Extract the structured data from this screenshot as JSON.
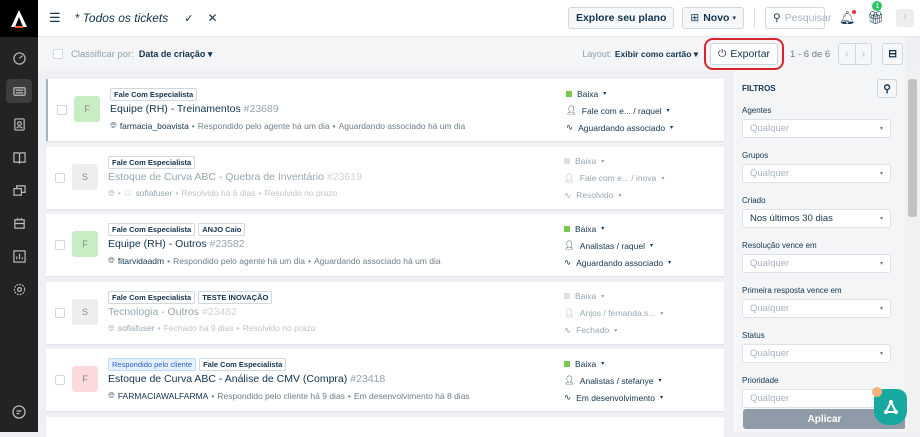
{
  "topbar": {
    "title": "* Todos os tickets",
    "explore": "Explore seu plano",
    "new": "Novo",
    "search_placeholder": "Pesquisar",
    "gift_badge": "1",
    "avatar": "I"
  },
  "subbar": {
    "sort_label": "Classificar por:",
    "sort_value": "Data de criação",
    "layout_label": "Layout:",
    "layout_value": "Exibir como cartão",
    "export": "Exportar",
    "pagination": "1 - 6 de 6"
  },
  "tickets": [
    {
      "avatar": "F",
      "avatar_color": "#c8ecc4",
      "tags": [
        "Fale Com Especialista"
      ],
      "subject": "Equipe (RH) - Treinamentos",
      "number": "#23689",
      "requester": "farmacia_boavista",
      "meta1": "Respondido pelo agente há um dia",
      "meta2": "Aguardando associado há um dia",
      "priority": "Baixa",
      "group": "Fale com e... / raquel",
      "status": "Aguardando associado",
      "dim": false
    },
    {
      "avatar": "S",
      "avatar_color": "#eeeeee",
      "tags": [
        "Fale Com Especialista"
      ],
      "subject": "Estoque de Curva ABC - Quebra de Inventário",
      "number": "#23619",
      "requester": "sofiafuser",
      "meta1": "Resolvido há 6 dias",
      "meta2": "Resolvido no prazo",
      "priority": "Baixa",
      "group": "Fale com e... / inova",
      "status": "Resolvido",
      "dim": true
    },
    {
      "avatar": "F",
      "avatar_color": "#c8ecc4",
      "tags": [
        "Fale Com Especialista",
        "ANJO Caio"
      ],
      "subject": "Equipe (RH) - Outros",
      "number": "#23582",
      "requester": "fitarvidaadm",
      "meta1": "Respondido pelo agente há um dia",
      "meta2": "Aguardando associado há um dia",
      "priority": "Baixa",
      "group": "Analistas / raquel",
      "status": "Aguardando associado",
      "dim": false
    },
    {
      "avatar": "S",
      "avatar_color": "#eeeeee",
      "tags": [
        "Fale Com Especialista",
        "TESTE INOVAÇÃO"
      ],
      "subject": "Tecnologia - Outros",
      "number": "#23482",
      "requester": "sofiafuser",
      "meta1": "Fechado há 9 dias",
      "meta2": "Resolvido no prazo",
      "priority": "Baixa",
      "group": "Anjos / fernanda.s...",
      "status": "Fechado",
      "dim": true
    },
    {
      "avatar": "F",
      "avatar_color": "#fcd9dc",
      "tags": [
        "Respondido pelo cliente",
        "Fale Com Especialista"
      ],
      "subject": "Estoque de Curva ABC - Análise de CMV (Compra)",
      "number": "#23418",
      "requester": "FARMACIAWALFARMA",
      "meta1": "Respondido pelo cliente há 9 dias",
      "meta2": "Em desenvolvimento há 8 dias",
      "priority": "Baixa",
      "group": "Analistas / stefanye",
      "status": "Em desenvolvimento",
      "dim": false
    }
  ],
  "filters": {
    "title": "FILTROS",
    "apply": "Aplicar",
    "fields": [
      {
        "label": "Agentes",
        "value": "Qualquer"
      },
      {
        "label": "Grupos",
        "value": "Qualquer"
      },
      {
        "label": "Criado",
        "value": "Nos últimos 30 dias"
      },
      {
        "label": "Resolução vence em",
        "value": "Qualquer"
      },
      {
        "label": "Primeira resposta vence em",
        "value": "Qualquer"
      },
      {
        "label": "Status",
        "value": "Qualquer"
      },
      {
        "label": "Prioridade",
        "value": "Qualquer"
      }
    ]
  }
}
